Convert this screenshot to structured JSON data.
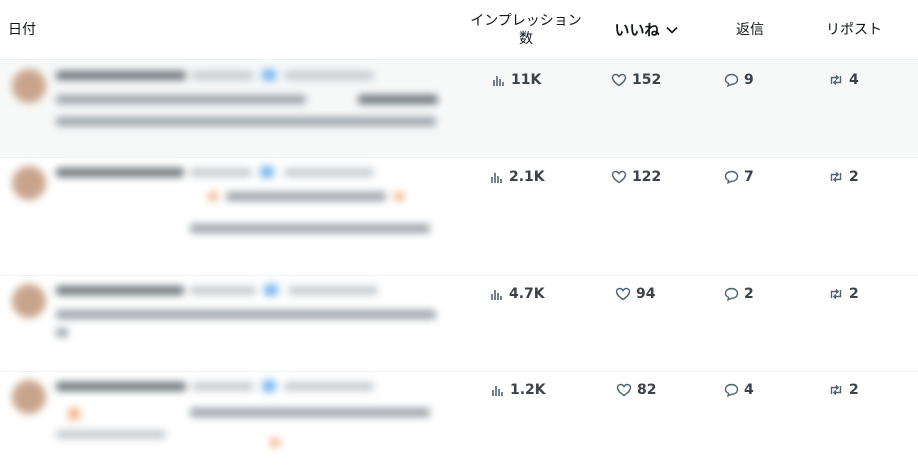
{
  "header": {
    "date": "日付",
    "impressions": "インプレッション数",
    "likes": "いいね",
    "likes_sort_icon": "chevron-down-icon",
    "replies": "返信",
    "reposts": "リポスト"
  },
  "rows": [
    {
      "impressions": "11K",
      "likes": "152",
      "replies": "9",
      "reposts": "4"
    },
    {
      "impressions": "2.1K",
      "likes": "122",
      "replies": "7",
      "reposts": "2"
    },
    {
      "impressions": "4.7K",
      "likes": "94",
      "replies": "2",
      "reposts": "2"
    },
    {
      "impressions": "1.2K",
      "likes": "82",
      "replies": "4",
      "reposts": "2"
    }
  ],
  "icons": {
    "impressions": "bar-chart-icon",
    "likes": "heart-icon",
    "replies": "reply-bubble-icon",
    "reposts": "repost-icon"
  },
  "colors": {
    "text": "#0f1419",
    "muted": "#536471",
    "border": "#eff3f4",
    "highlight_row": "#f7f9f9"
  }
}
